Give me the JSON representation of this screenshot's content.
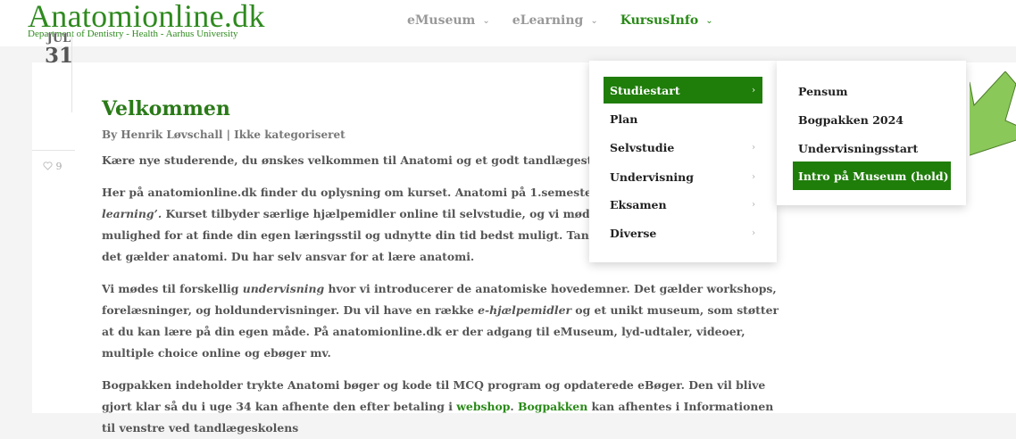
{
  "header": {
    "logo_title": "Anatomionline.dk",
    "logo_subtitle": "Department of Dentistry - Health - Aarhus University",
    "nav": [
      {
        "label": "eMuseum"
      },
      {
        "label": "eLearning"
      },
      {
        "label": "KursusInfo"
      }
    ],
    "chevron": "⌄"
  },
  "post": {
    "date_month": "JUL",
    "date_day": "31",
    "likes": "9",
    "title": "Velkommen",
    "meta": "By Henrik Løvschall | Ikke kategoriseret",
    "p1": "Kære nye studerende, du ønskes velkommen til Anatomi og et godt tandlægestudie",
    "p2_line1_a": "Her på anatomionline.dk finder du oplysning om kurset. Anatomi på 1.semester er et af de ‘s",
    "p2_line2_em": "learning’.",
    "p2_line2_b": " Kurset tilbyder særlige hjælpemidler online til selvstudie, og vi mødes også til und",
    "p2_line3": "mulighed for at finde din egen læringsstil og udnytte din tid bedst muligt. Tandlægestudiet l",
    "p2_line4": "det gælder anatomi. Du har selv ansvar for at lære anatomi.",
    "p3_a": "Vi mødes til forskellig ",
    "p3_em1": "undervisning",
    "p3_b": " hvor vi introducerer de anatomiske hovedemner. Det gælder workshops, forelæsninger, og holdundervisninger. Du vil have en række ",
    "p3_em2": "e-hjælpemidler",
    "p3_c": " og et unikt museum, som støtter at du kan lære på din egen måde. På anatomionline.dk er der adgang til eMuseum, lyd-udtaler, videoer, multiple choice online og ebøger mv.",
    "p4_a": "Bogpakken indeholder trykte Anatomi bøger og kode til MCQ program og opdaterede eBøger. Den vil blive gjort klar så du i uge 34 kan afhente den efter betaling i ",
    "p4_link1": "webshop",
    "p4_sep": ". ",
    "p4_link2": "Bogpakken",
    "p4_b": " kan afhentes i Informationen til venstre ved tandlægeskolens"
  },
  "dropdown": {
    "items": [
      {
        "label": "Studiestart",
        "chevron": "›"
      },
      {
        "label": "Plan",
        "chevron": ""
      },
      {
        "label": "Selvstudie",
        "chevron": "›"
      },
      {
        "label": "Undervisning",
        "chevron": "›"
      },
      {
        "label": "Eksamen",
        "chevron": "›"
      },
      {
        "label": "Diverse",
        "chevron": "›"
      }
    ]
  },
  "submenu": {
    "items": [
      {
        "label": "Pensum"
      },
      {
        "label": "Bogpakken 2024"
      },
      {
        "label": "Undervisningsstart"
      },
      {
        "label": "Intro på Museum (hold)"
      }
    ]
  },
  "colors": {
    "brand_green": "#2f8a1f",
    "active_bg": "#1f7d0a",
    "arrow_green": "#8ac85a"
  }
}
